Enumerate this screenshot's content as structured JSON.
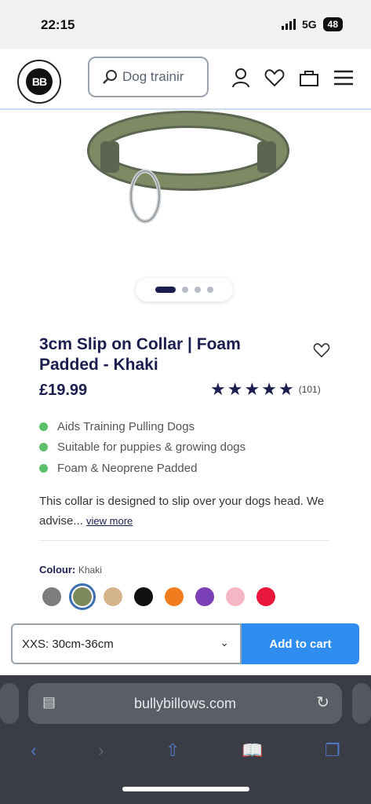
{
  "status": {
    "time": "22:15",
    "network": "5G",
    "battery": "48"
  },
  "header": {
    "logo_text": "BB",
    "search_placeholder": "Dog trainir",
    "icons": [
      "search-icon",
      "account-icon",
      "wishlist-heart-icon",
      "bag-icon",
      "menu-icon"
    ]
  },
  "product": {
    "image_alt": "khaki padded slip collar",
    "gallery_dots": 4,
    "gallery_active": 1,
    "title": "3cm Slip on Collar | Foam Padded - Khaki",
    "price": "£19.99",
    "rating_stars": 5,
    "review_count": "(101)",
    "features": [
      "Aids Training Pulling Dogs",
      "Suitable for puppies & growing dogs",
      "Foam & Neoprene Padded"
    ],
    "description": "This collar is designed to slip over your dogs head. We advise...",
    "view_more": "view more",
    "colour_label": "Colour:",
    "colour_value": "Khaki",
    "swatches": [
      "#7b7d7f",
      "#7d8a5c",
      "#d2b48c",
      "#111111",
      "#f07c1e",
      "#7b3fb8",
      "#f4b7c6",
      "#e8163a"
    ],
    "selected_swatch": 1
  },
  "cart": {
    "size": "XXS: 30cm-36cm",
    "add_label": "Add to cart"
  },
  "browser": {
    "url": "bullybillows.com"
  }
}
